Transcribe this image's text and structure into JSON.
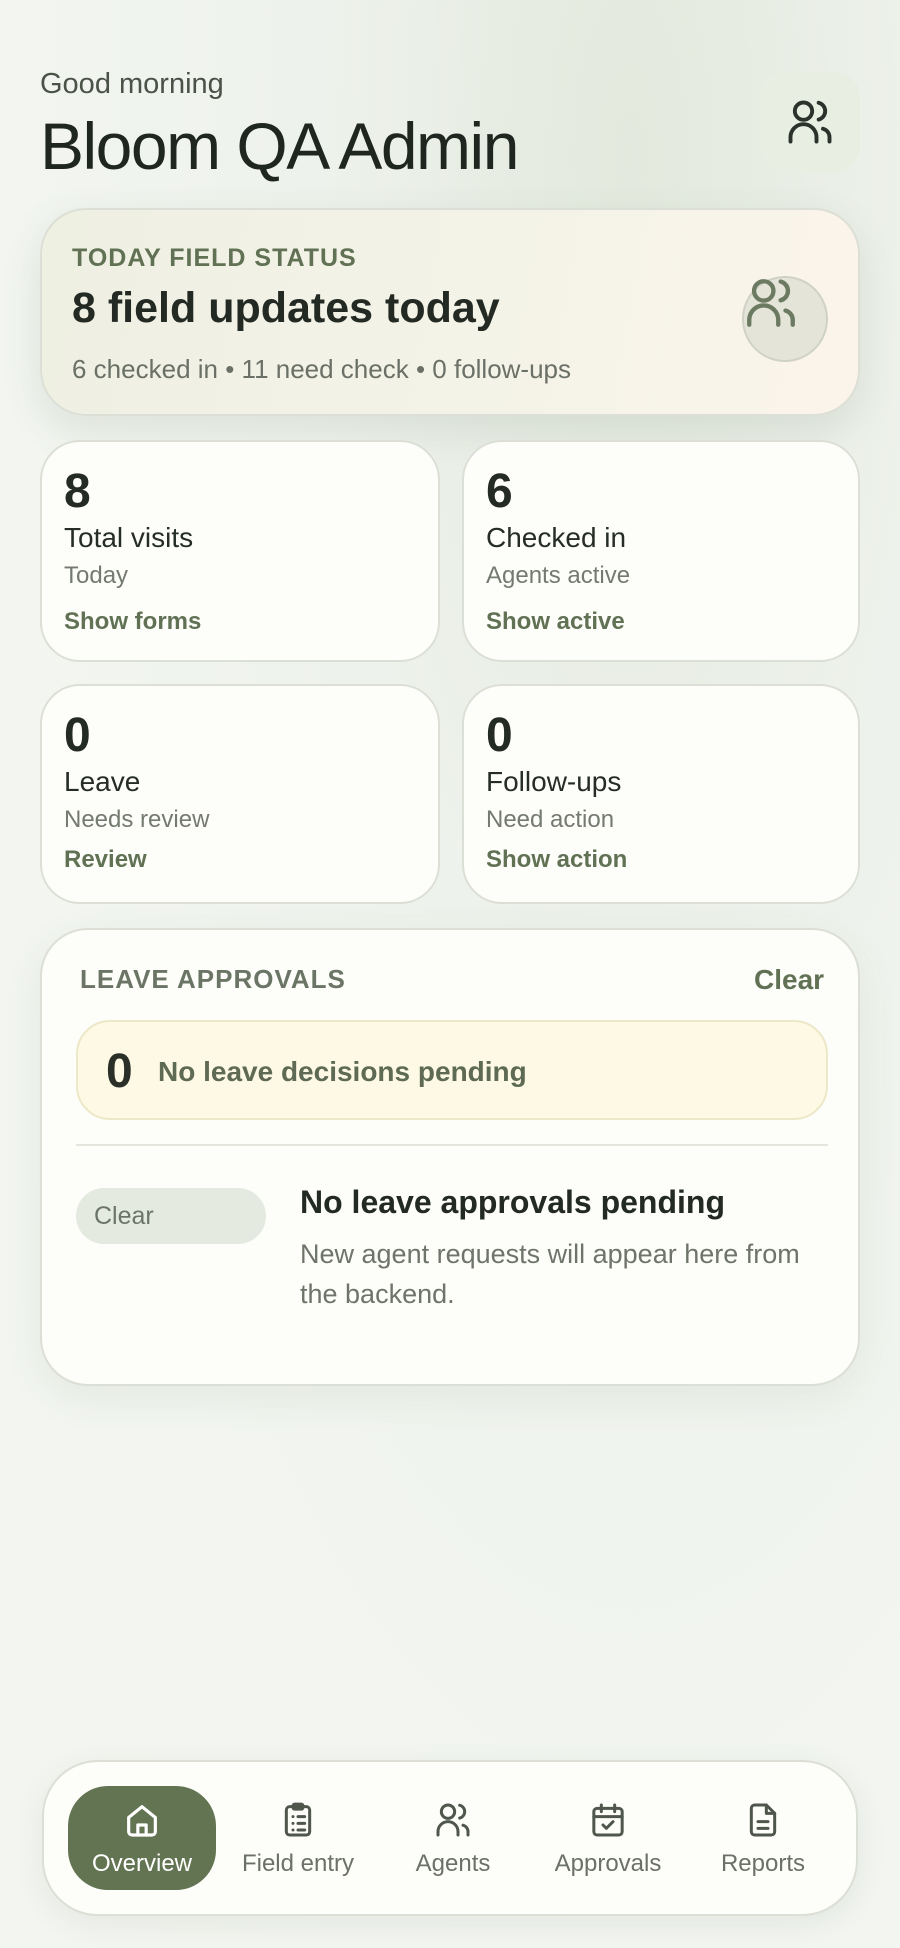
{
  "header": {
    "greeting": "Good morning",
    "title": "Bloom QA Admin",
    "avatar_icon": "users-icon"
  },
  "status": {
    "eyebrow": "TODAY FIELD STATUS",
    "headline": "8 field updates today",
    "summary": "6 checked in • 11 need check • 0 follow-ups",
    "icon": "users-icon"
  },
  "stats": [
    {
      "value": "8",
      "label": "Total visits",
      "sub": "Today",
      "action": "Show forms"
    },
    {
      "value": "6",
      "label": "Checked in",
      "sub": "Agents active",
      "action": "Show active"
    },
    {
      "value": "0",
      "label": "Leave",
      "sub": "Needs review",
      "action": "Review"
    },
    {
      "value": "0",
      "label": "Follow-ups",
      "sub": "Need action",
      "action": "Show action"
    }
  ],
  "leave": {
    "eyebrow": "LEAVE APPROVALS",
    "clear_label": "Clear",
    "pending_count": "0",
    "pending_text": "No leave decisions pending",
    "chip_label": "Clear",
    "empty_title": "No leave approvals pending",
    "empty_desc": "New agent requests will appear here from the backend."
  },
  "nav": {
    "items": [
      {
        "label": "Overview",
        "icon": "home-icon",
        "active": true
      },
      {
        "label": "Field entry",
        "icon": "clipboard-icon",
        "active": false
      },
      {
        "label": "Agents",
        "icon": "users-icon",
        "active": false
      },
      {
        "label": "Approvals",
        "icon": "calendar-check-icon",
        "active": false
      },
      {
        "label": "Reports",
        "icon": "document-icon",
        "active": false
      }
    ]
  },
  "colors": {
    "accent": "#637452",
    "accent_text": "#617154",
    "background": "#f2f5f0",
    "card": "#fdfdf9",
    "pending_bg": "#fdf9e4"
  }
}
